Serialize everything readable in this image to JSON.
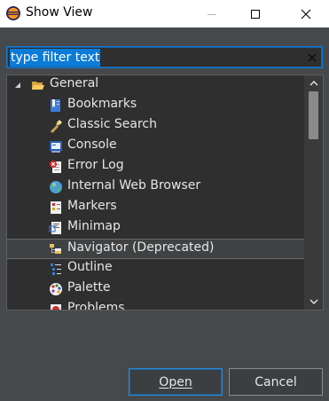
{
  "window": {
    "title": "Show View",
    "icon": "eclipse-icon"
  },
  "filter": {
    "value": "type filter text"
  },
  "tree": {
    "group": {
      "label": "General",
      "icon": "folder-open-icon",
      "expanded": true
    },
    "items": [
      {
        "label": "Bookmarks",
        "icon": "bookmarks-icon",
        "selected": false
      },
      {
        "label": "Classic Search",
        "icon": "flashlight-icon",
        "selected": false
      },
      {
        "label": "Console",
        "icon": "console-icon",
        "selected": false
      },
      {
        "label": "Error Log",
        "icon": "error-log-icon",
        "selected": false
      },
      {
        "label": "Internal Web Browser",
        "icon": "globe-icon",
        "selected": false
      },
      {
        "label": "Markers",
        "icon": "markers-icon",
        "selected": false
      },
      {
        "label": "Minimap",
        "icon": "minimap-icon",
        "selected": false
      },
      {
        "label": "Navigator (Deprecated)",
        "icon": "navigator-icon",
        "selected": true
      },
      {
        "label": "Outline",
        "icon": "outline-icon",
        "selected": false
      },
      {
        "label": "Palette",
        "icon": "palette-icon",
        "selected": false
      },
      {
        "label": "Problems",
        "icon": "problems-icon",
        "selected": false
      }
    ]
  },
  "buttons": {
    "open": "Open",
    "cancel": "Cancel"
  },
  "colors": {
    "accent": "#0b7bd8",
    "background": "#46494b",
    "tree_background": "#2f2f2f"
  }
}
